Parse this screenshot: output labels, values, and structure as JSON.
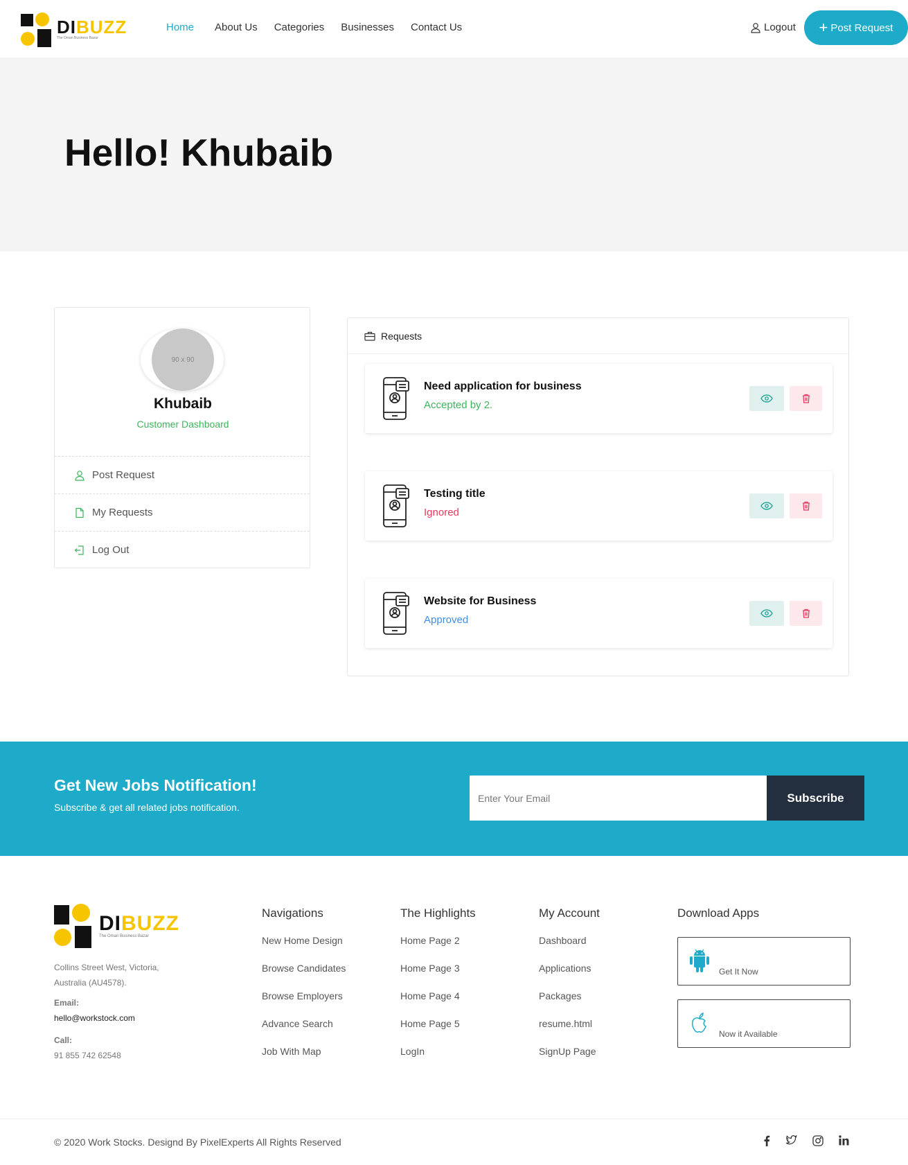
{
  "brand": {
    "name_a": "DI",
    "name_b": "BUZZ",
    "tagline": "The Oman Business Bazar"
  },
  "nav": {
    "items": [
      "Home",
      "About Us",
      "Categories",
      "Businesses",
      "Contact Us"
    ],
    "logout": "Logout",
    "post_request": "Post Request"
  },
  "hero": {
    "greeting": "Hello! Khubaib"
  },
  "profile": {
    "avatar_placeholder": "90 x 90",
    "name": "Khubaib",
    "role": "Customer Dashboard",
    "menu": [
      "Post Request",
      "My Requests",
      "Log Out"
    ]
  },
  "requests": {
    "heading": "Requests",
    "items": [
      {
        "title": "Need application for business",
        "status": "Accepted by 2.",
        "status_color": "#3cb55a"
      },
      {
        "title": "Testing title",
        "status": "Ignored",
        "status_color": "#e63a5e"
      },
      {
        "title": "Website for Business",
        "status": "Approved",
        "status_color": "#3d8fe0"
      }
    ]
  },
  "newsletter": {
    "title": "Get New Jobs Notification!",
    "subtitle": "Subscribe & get all related jobs notification.",
    "placeholder": "Enter Your Email",
    "button": "Subscribe"
  },
  "footer": {
    "address": "Collins Street West, Victoria, Australia (AU4578).",
    "email_label": "Email:",
    "email": "hello@workstock.com",
    "call_label": "Call:",
    "phone": "91 855 742 62548",
    "columns": [
      {
        "title": "Navigations",
        "links": [
          "New Home Design",
          "Browse Candidates",
          "Browse Employers",
          "Advance Search",
          "Job With Map"
        ]
      },
      {
        "title": "The Highlights",
        "links": [
          "Home Page 2",
          "Home Page 3",
          "Home Page 4",
          "Home Page 5",
          "LogIn"
        ]
      },
      {
        "title": "My Account",
        "links": [
          "Dashboard",
          "Applications",
          "Packages",
          "resume.html",
          "SignUp Page"
        ]
      }
    ],
    "apps_title": "Download Apps",
    "apps": [
      "Get It Now",
      "Now it Available"
    ],
    "copyright": "© 2020 Work Stocks. Designd By PixelExperts All Rights Reserved",
    "social": [
      "facebook-icon",
      "twitter-icon",
      "instagram-icon",
      "linkedin-icon"
    ]
  },
  "colors": {
    "accent": "#1eabc9",
    "brand_yellow": "#f7c400",
    "dark": "#232f3e"
  }
}
